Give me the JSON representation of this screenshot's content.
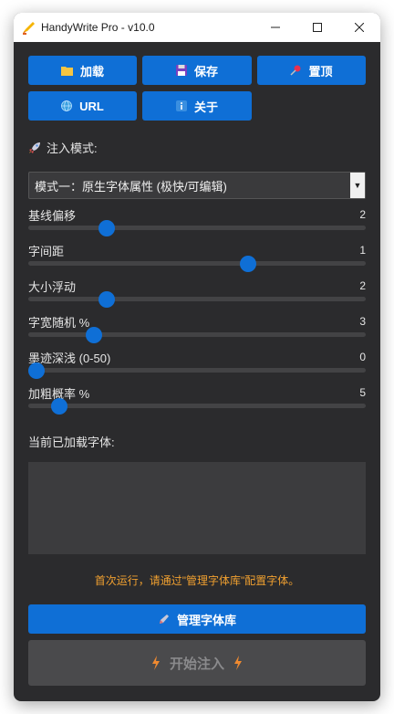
{
  "window": {
    "title": "HandyWrite Pro - v10.0",
    "controls": {
      "minimize": "—",
      "maximize": "☐",
      "close": "✕"
    }
  },
  "toolbar": {
    "load_label": "加载",
    "save_label": "保存",
    "pin_label": "置顶",
    "url_label": "URL",
    "about_label": "关于"
  },
  "mode": {
    "label": "注入模式:",
    "selected": "模式一：原生字体属性 (极快/可编辑)"
  },
  "sliders": {
    "baseline": {
      "label": "基线偏移",
      "value": "2",
      "fraction": 0.22
    },
    "spacing": {
      "label": "字间距",
      "value": "1",
      "fraction": 0.66
    },
    "size_float": {
      "label": "大小浮动",
      "value": "2",
      "fraction": 0.22
    },
    "width_random": {
      "label": "字宽随机 %",
      "value": "3",
      "fraction": 0.18
    },
    "ink_depth": {
      "label": "墨迹深浅 (0-50)",
      "value": "0",
      "fraction": 0.0
    },
    "bold_prob": {
      "label": "加粗概率 %",
      "value": "5",
      "fraction": 0.07
    }
  },
  "fonts": {
    "label": "当前已加载字体:"
  },
  "hint": "首次运行，请通过\"管理字体库\"配置字体。",
  "manage_label": "管理字体库",
  "start_label": "开始注入",
  "colors": {
    "accent": "#0f6fd6",
    "background": "#2b2b2d",
    "hint": "#f0a030",
    "disabled": "#4a4a4c"
  },
  "icons": {
    "load": "folder-icon",
    "save": "floppy-icon",
    "pin": "pushpin-icon",
    "url": "globe-icon",
    "about": "info-icon",
    "mode": "rocket-icon",
    "manage": "pen-icon",
    "start": "lightning-icon"
  }
}
